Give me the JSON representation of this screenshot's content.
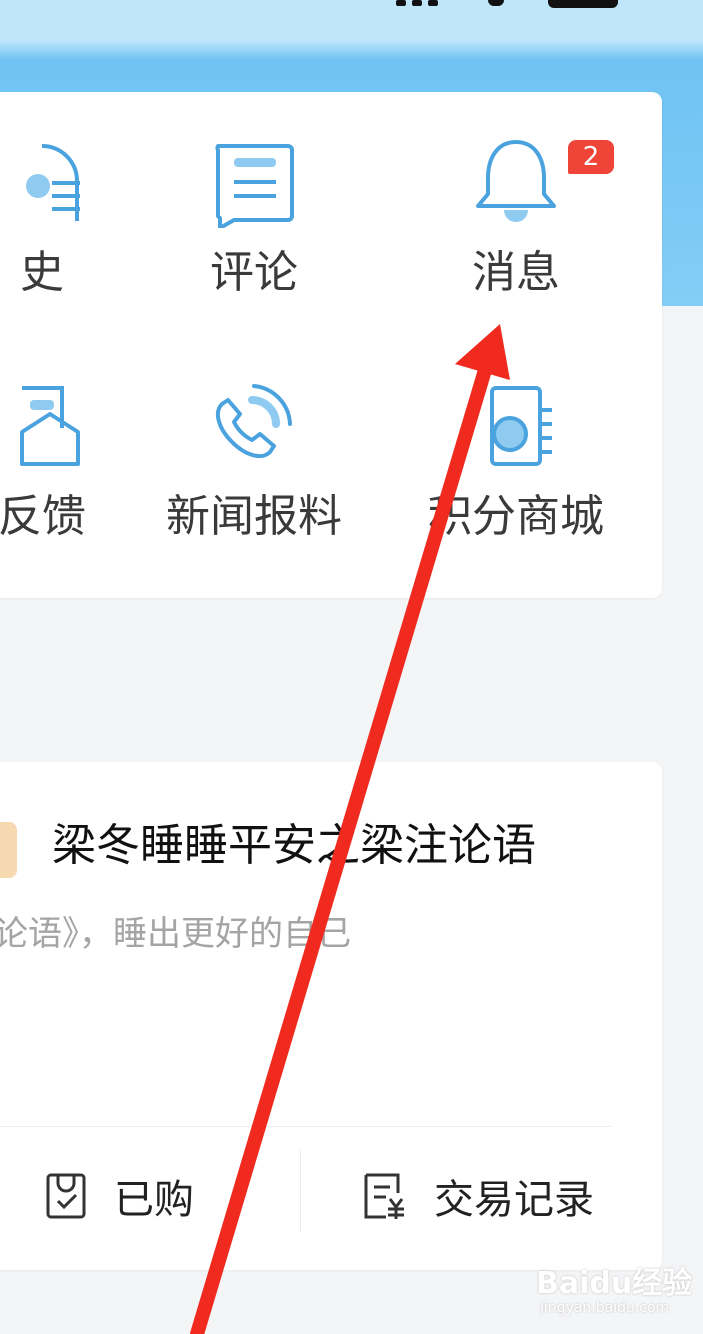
{
  "status_bar": {},
  "menu": {
    "row1": [
      {
        "label": "史",
        "icon": "history-icon"
      },
      {
        "label": "评论",
        "icon": "comment-icon"
      },
      {
        "label": "消息",
        "icon": "bell-icon",
        "badge": "2"
      }
    ],
    "row2": [
      {
        "label": "反馈",
        "icon": "feedback-icon"
      },
      {
        "label": "新闻报料",
        "icon": "phone-icon"
      },
      {
        "label": "积分商城",
        "icon": "store-icon"
      }
    ]
  },
  "product": {
    "title": "梁冬睡睡平安之梁注论语",
    "description": "论语》，睡出更好的自己",
    "purchased_label": "已购",
    "transactions_label": "交易记录"
  },
  "watermark": {
    "main": "Baidu经验",
    "sub": "jingyan.baidu.com"
  },
  "colors": {
    "header_blue": "#83cdf6",
    "icon_blue": "#4aa3df",
    "badge_red": "#ef4438",
    "arrow_red": "#f02a1f"
  }
}
